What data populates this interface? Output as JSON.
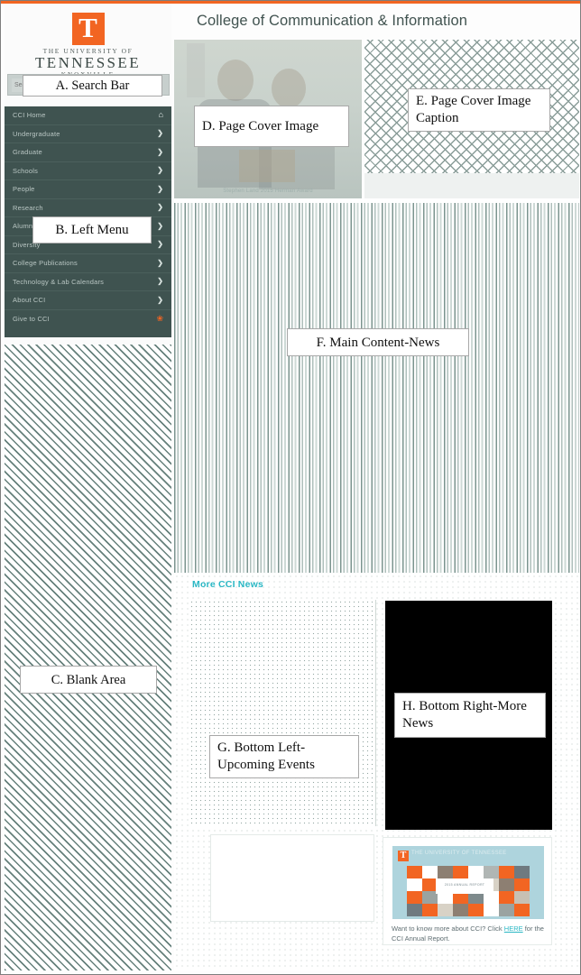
{
  "header": {
    "title": "College of Communication & Information",
    "accent_orange": "#f26522",
    "accent_teal": "#2ab7c4"
  },
  "branding": {
    "mark_letter": "T",
    "line1": "THE UNIVERSITY OF",
    "line2": "TENNESSEE",
    "line3": "KNOXVILLE"
  },
  "search": {
    "placeholder": "Search",
    "value": ""
  },
  "sidebar": {
    "items": [
      {
        "label": "CCI Home",
        "icon": "home-icon",
        "glyph": "⌂"
      },
      {
        "label": "Undergraduate",
        "icon": "chevron-right-icon",
        "glyph": "❯"
      },
      {
        "label": "Graduate",
        "icon": "chevron-right-icon",
        "glyph": "❯"
      },
      {
        "label": "Schools",
        "icon": "chevron-right-icon",
        "glyph": "❯"
      },
      {
        "label": "People",
        "icon": "chevron-right-icon",
        "glyph": "❯"
      },
      {
        "label": "Research",
        "icon": "chevron-right-icon",
        "glyph": "❯"
      },
      {
        "label": "Alumni",
        "icon": "chevron-right-icon",
        "glyph": "❯"
      },
      {
        "label": "Diversity",
        "icon": "chevron-right-icon",
        "glyph": "❯"
      },
      {
        "label": "College Publications",
        "icon": "chevron-right-icon",
        "glyph": "❯"
      },
      {
        "label": "Technology & Lab Calendars",
        "icon": "chevron-right-icon",
        "glyph": "❯"
      },
      {
        "label": "About CCI",
        "icon": "chevron-right-icon",
        "glyph": "❯"
      },
      {
        "label": "Give to CCI",
        "icon": "gift-icon",
        "glyph": "❀"
      }
    ]
  },
  "cover": {
    "photo_caption": "Stephen Land 2015 Herman Award"
  },
  "news": {
    "more_heading": "More CCI News"
  },
  "annual_report": {
    "logo_letter": "T",
    "logo_text": "THE UNIVERSITY OF TENNESSEE",
    "center_text": "2015 ANNUAL REPORT",
    "blurb_before": "Want to know more about CCI? Click ",
    "link": "HERE",
    "blurb_after": " for the CCI Annual Report."
  },
  "annotations": {
    "a": "A.  Search Bar",
    "b": "B. Left Menu",
    "c": "C. Blank  Area",
    "d": "D. Page Cover Image",
    "e": "E. Page Cover Image Caption",
    "f": "F. Main Content-News",
    "g": "G. Bottom Left-Upcoming Events",
    "h": "H. Bottom Right-More News"
  }
}
